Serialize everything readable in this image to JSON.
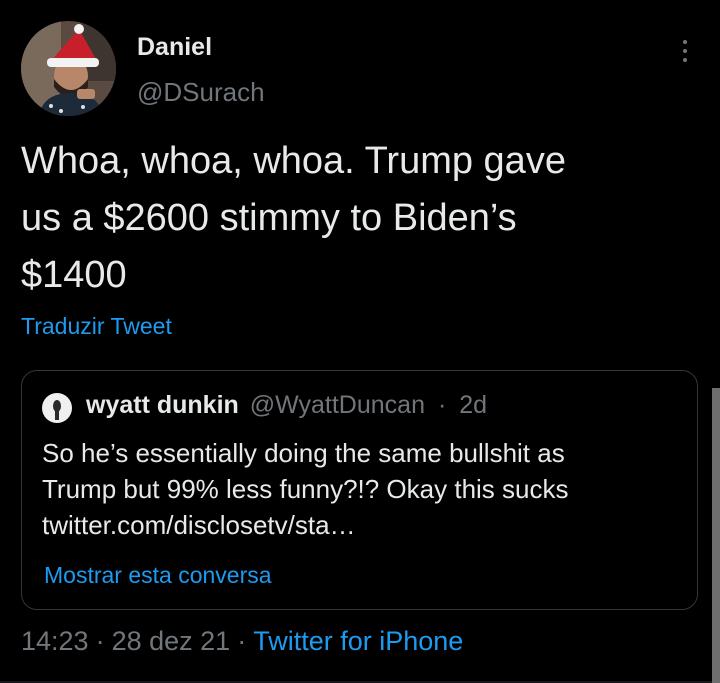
{
  "author": {
    "display_name": "Daniel",
    "handle": "@DSurach"
  },
  "tweet": {
    "text": "Whoa, whoa, whoa. Trump gave\nus a $2600 stimmy to Biden’s\n$1400",
    "translate_label": "Traduzir Tweet"
  },
  "quoted_tweet": {
    "display_name": "wyatt dunkin",
    "handle": "@WyattDuncan",
    "separator": "·",
    "time": "2d",
    "text": "So he’s essentially doing the same bullshit as\nTrump but 99% less funny?!? Okay this sucks\ntwitter.com/disclosetv/sta…",
    "show_thread_label": "Mostrar esta conversa"
  },
  "meta": {
    "time": "14:23",
    "separator": "·",
    "date": "28 dez 21",
    "source": "Twitter for iPhone"
  },
  "colors": {
    "background": "#000000",
    "text": "#e7e9ea",
    "secondary": "#71767b",
    "link": "#1d9bf0",
    "border": "#333639"
  },
  "icons": {
    "more": "more-vertical-icon"
  }
}
